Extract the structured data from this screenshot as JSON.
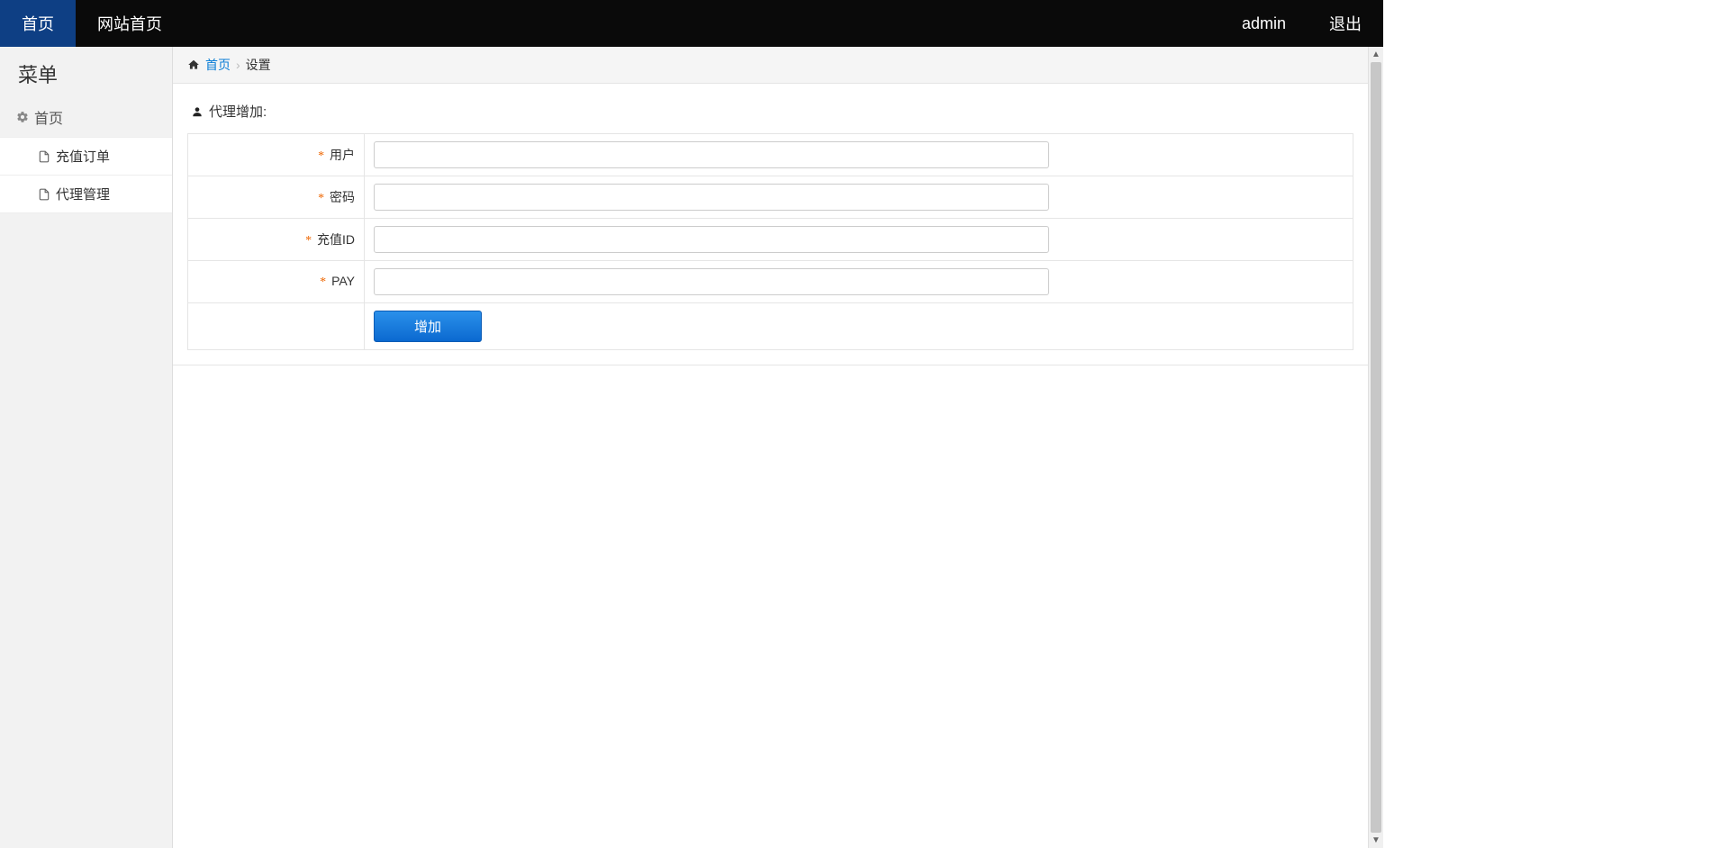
{
  "navbar": {
    "home_tab": "首页",
    "site_home": "网站首页",
    "user": "admin",
    "logout": "退出"
  },
  "sidebar": {
    "title": "菜单",
    "group_home": "首页",
    "items": [
      {
        "label": "充值订单"
      },
      {
        "label": "代理管理"
      }
    ]
  },
  "breadcrumb": {
    "home": "首页",
    "current": "设置"
  },
  "panel": {
    "title": "代理增加:"
  },
  "form": {
    "fields": {
      "user": {
        "label": "用户",
        "value": ""
      },
      "password": {
        "label": "密码",
        "value": ""
      },
      "recharge": {
        "label": "充值ID",
        "value": ""
      },
      "pay": {
        "label": "PAY",
        "value": ""
      }
    },
    "submit_label": "增加"
  }
}
